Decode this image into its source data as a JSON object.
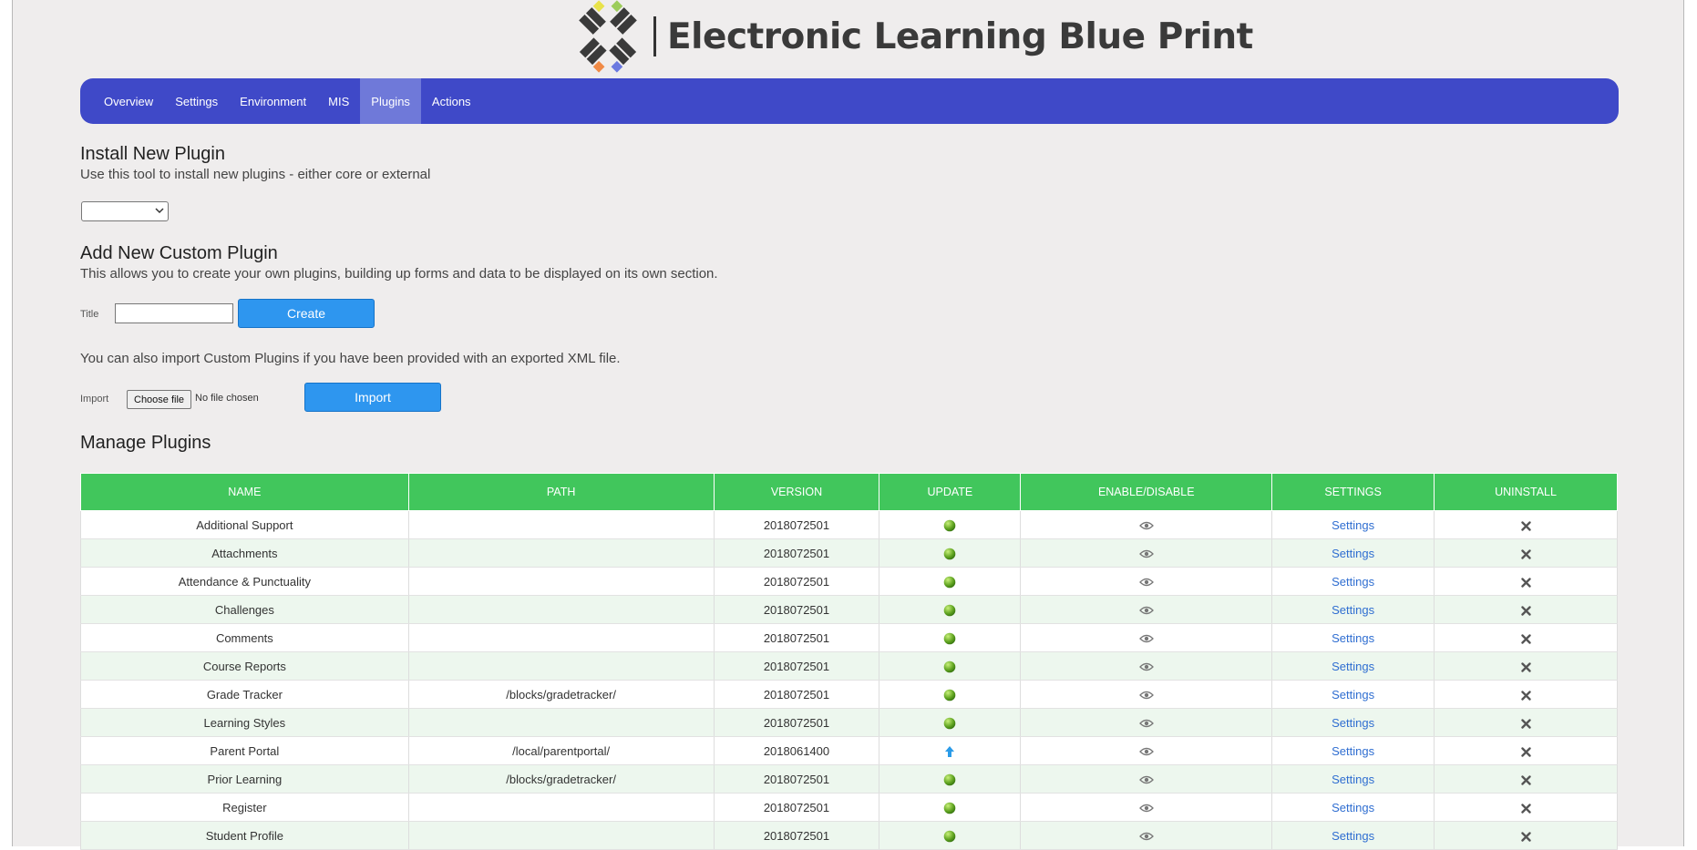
{
  "brand": {
    "title": "Electronic Learning Blue Print"
  },
  "nav": {
    "items": [
      "Overview",
      "Settings",
      "Environment",
      "MIS",
      "Plugins",
      "Actions"
    ],
    "active": "Plugins"
  },
  "install": {
    "title": "Install New Plugin",
    "description": "Use this tool to install new plugins - either core or external",
    "select_value": ""
  },
  "custom": {
    "title": "Add New Custom Plugin",
    "description": "This allows you to create your own plugins, building up forms and data to be displayed on its own section.",
    "title_label": "Title",
    "title_value": "",
    "create_label": "Create",
    "import_note": "You can also import Custom Plugins if you have been provided with an exported XML file.",
    "import_label": "Import",
    "choose_file_label": "Choose file",
    "file_status": "No file chosen",
    "import_button_label": "Import"
  },
  "manage": {
    "title": "Manage Plugins",
    "columns": [
      "NAME",
      "PATH",
      "VERSION",
      "UPDATE",
      "ENABLE/DISABLE",
      "SETTINGS",
      "UNINSTALL"
    ],
    "rows": [
      {
        "name": "Additional Support",
        "path": "",
        "version": "2018072501",
        "update": "ok",
        "settings": "Settings"
      },
      {
        "name": "Attachments",
        "path": "",
        "version": "2018072501",
        "update": "ok",
        "settings": "Settings"
      },
      {
        "name": "Attendance & Punctuality",
        "path": "",
        "version": "2018072501",
        "update": "ok",
        "settings": "Settings"
      },
      {
        "name": "Challenges",
        "path": "",
        "version": "2018072501",
        "update": "ok",
        "settings": "Settings"
      },
      {
        "name": "Comments",
        "path": "",
        "version": "2018072501",
        "update": "ok",
        "settings": "Settings"
      },
      {
        "name": "Course Reports",
        "path": "",
        "version": "2018072501",
        "update": "ok",
        "settings": "Settings"
      },
      {
        "name": "Grade Tracker",
        "path": "/blocks/gradetracker/",
        "version": "2018072501",
        "update": "ok",
        "settings": "Settings"
      },
      {
        "name": "Learning Styles",
        "path": "",
        "version": "2018072501",
        "update": "ok",
        "settings": "Settings"
      },
      {
        "name": "Parent Portal",
        "path": "/local/parentportal/",
        "version": "2018061400",
        "update": "available",
        "settings": "Settings"
      },
      {
        "name": "Prior Learning",
        "path": "/blocks/gradetracker/",
        "version": "2018072501",
        "update": "ok",
        "settings": "Settings"
      },
      {
        "name": "Register",
        "path": "",
        "version": "2018072501",
        "update": "ok",
        "settings": "Settings"
      },
      {
        "name": "Student Profile",
        "path": "",
        "version": "2018072501",
        "update": "ok",
        "settings": "Settings"
      }
    ]
  },
  "colors": {
    "nav": "#3f49c8",
    "table_header": "#41c65c",
    "button": "#2e96ef",
    "link": "#2f6ed1"
  },
  "icons": {
    "update_ok": "green-globe-icon",
    "update_available": "blue-up-arrow-icon",
    "enable": "eye-icon",
    "uninstall": "x-icon"
  }
}
